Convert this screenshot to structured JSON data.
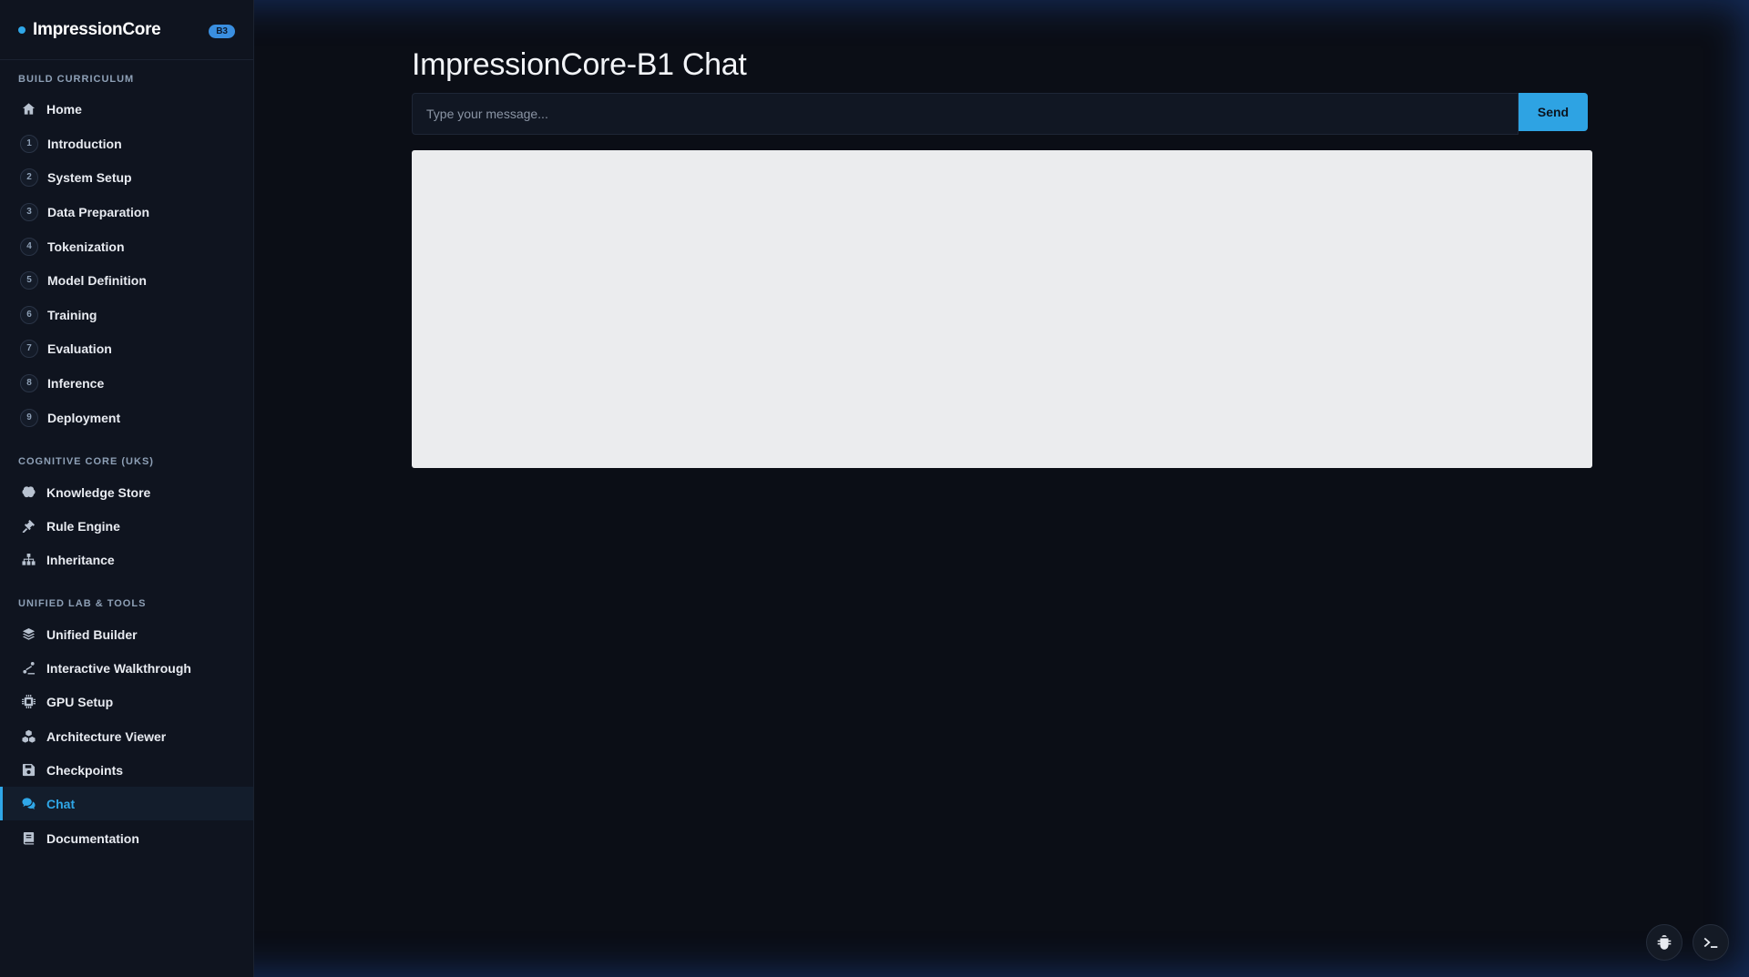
{
  "brand": {
    "name": "ImpressionCore",
    "badge": "B3"
  },
  "sidebar": {
    "sections": [
      {
        "title": "Build Curriculum"
      },
      {
        "title": "Cognitive Core (UKS)"
      },
      {
        "title": "Unified Lab & Tools"
      }
    ],
    "curriculum": [
      {
        "label": "Home",
        "icon": "home-icon"
      },
      {
        "num": "1",
        "label": "Introduction"
      },
      {
        "num": "2",
        "label": "System Setup"
      },
      {
        "num": "3",
        "label": "Data Preparation"
      },
      {
        "num": "4",
        "label": "Tokenization"
      },
      {
        "num": "5",
        "label": "Model Definition"
      },
      {
        "num": "6",
        "label": "Training"
      },
      {
        "num": "7",
        "label": "Evaluation"
      },
      {
        "num": "8",
        "label": "Inference"
      },
      {
        "num": "9",
        "label": "Deployment"
      }
    ],
    "cognitive": [
      {
        "label": "Knowledge Store",
        "icon": "brain-icon"
      },
      {
        "label": "Rule Engine",
        "icon": "gavel-icon"
      },
      {
        "label": "Inheritance",
        "icon": "sitemap-icon"
      }
    ],
    "lab": [
      {
        "label": "Unified Builder",
        "icon": "layers-icon"
      },
      {
        "label": "Interactive Walkthrough",
        "icon": "walkthrough-icon"
      },
      {
        "label": "GPU Setup",
        "icon": "chip-icon"
      },
      {
        "label": "Architecture Viewer",
        "icon": "cubes-icon"
      },
      {
        "label": "Checkpoints",
        "icon": "save-icon"
      },
      {
        "label": "Chat",
        "icon": "comments-icon",
        "active": true
      },
      {
        "label": "Documentation",
        "icon": "book-icon"
      }
    ]
  },
  "main": {
    "title": "ImpressionCore-B1 Chat",
    "input_placeholder": "Type your message...",
    "input_value": "",
    "send_label": "Send"
  },
  "colors": {
    "accent": "#2ea3e3",
    "background": "#0b0e16",
    "sidebar": "#0f141f",
    "chat_panel": "#ebecee"
  },
  "floating_buttons": [
    {
      "icon": "bug-icon"
    },
    {
      "icon": "terminal-icon"
    }
  ]
}
